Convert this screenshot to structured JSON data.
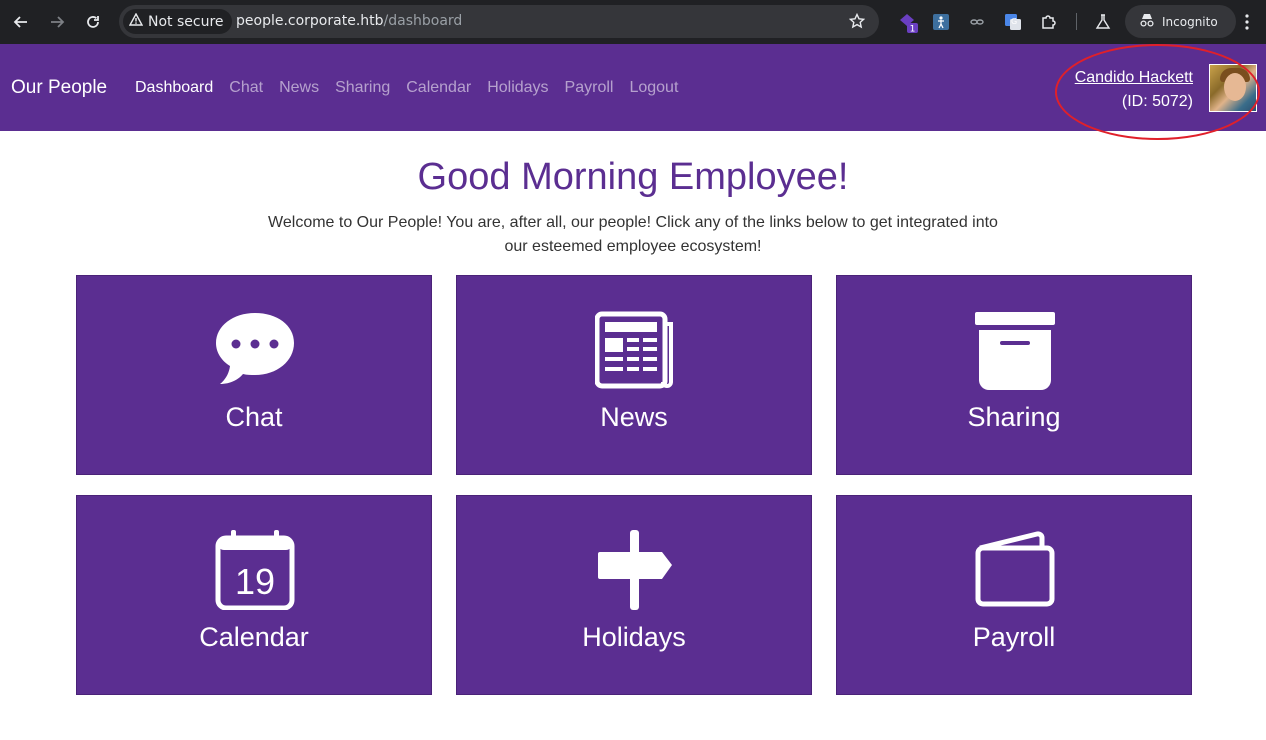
{
  "browser": {
    "security_label": "Not secure",
    "url_host": "people.corporate.htb",
    "url_path": "/dashboard",
    "extension_badge": "1",
    "incognito_label": "Incognito"
  },
  "nav": {
    "brand": "Our People",
    "links": [
      "Dashboard",
      "Chat",
      "News",
      "Sharing",
      "Calendar",
      "Holidays",
      "Payroll",
      "Logout"
    ],
    "active": "Dashboard"
  },
  "user": {
    "name": "Candido Hackett",
    "id_text": "(ID: 5072)"
  },
  "main": {
    "headline": "Good Morning Employee!",
    "intro": "Welcome to Our People! You are, after all, our people! Click any of the links below to get integrated into our esteemed employee ecosystem!",
    "tiles": [
      {
        "label": "Chat",
        "icon": "chat-bubble-icon"
      },
      {
        "label": "News",
        "icon": "newspaper-icon"
      },
      {
        "label": "Sharing",
        "icon": "archive-box-icon"
      },
      {
        "label": "Calendar",
        "icon": "calendar-icon",
        "day": "19"
      },
      {
        "label": "Holidays",
        "icon": "signpost-icon"
      },
      {
        "label": "Payroll",
        "icon": "wallet-icon"
      }
    ]
  },
  "colors": {
    "brand_purple": "#5b2e91",
    "highlight_red": "#e0202a"
  }
}
